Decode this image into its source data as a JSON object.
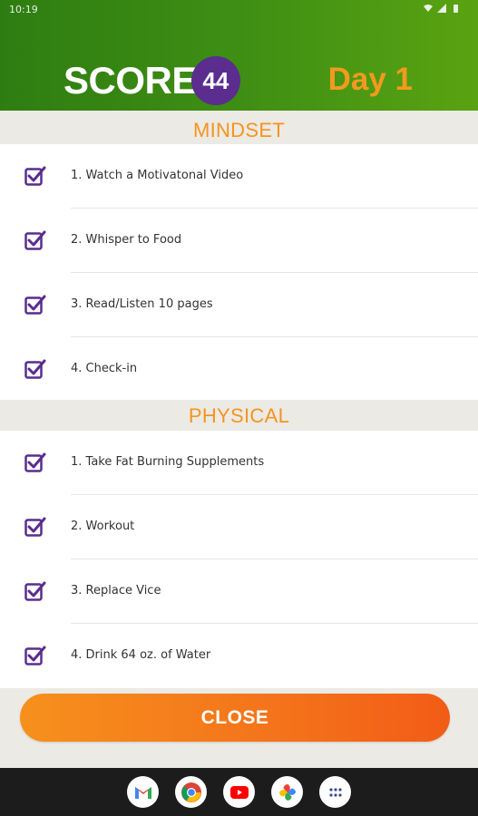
{
  "status_bar": {
    "time": "10:19"
  },
  "header": {
    "logo_text": "SCORE",
    "logo_badge": "44",
    "day_label": "Day 1"
  },
  "sections": {
    "mindset": {
      "title": "MINDSET",
      "items": [
        "1. Watch a Motivatonal Video",
        "2. Whisper to Food",
        "3. Read/Listen 10 pages",
        "4. Check-in"
      ]
    },
    "physical": {
      "title": "PHYSICAL",
      "items": [
        "1. Take Fat Burning Supplements",
        "2. Workout",
        "3. Replace Vice",
        "4. Drink 64 oz. of Water"
      ]
    }
  },
  "close_label": "CLOSE",
  "dock_apps": [
    "gmail-icon",
    "chrome-icon",
    "youtube-icon",
    "photos-icon",
    "app-drawer-icon"
  ],
  "colors": {
    "header_green": "#3f8e14",
    "accent_orange": "#f5941f",
    "check_purple": "#5a2d8e",
    "badge_purple": "#5a2d8e"
  }
}
